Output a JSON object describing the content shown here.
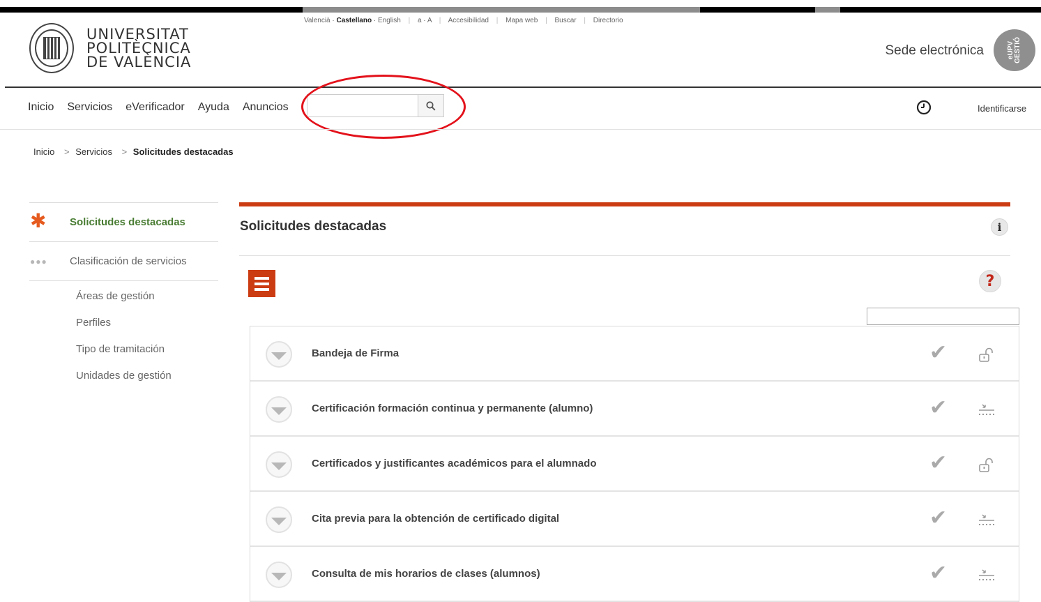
{
  "header": {
    "logo_lines": [
      "UNIVERSITAT",
      "POLITÈCNICA",
      "DE VALÈNCIA"
    ],
    "utility_links": {
      "valencia": "Valencià",
      "castellano": "Castellano",
      "english": "English",
      "text_size": "a · A",
      "accesibilidad": "Accesibilidad",
      "mapa_web": "Mapa web",
      "buscar": "Buscar",
      "directorio": "Directorio"
    },
    "sede": "Sede electrónica",
    "badge": "eUPV\nGESTIÓ"
  },
  "nav": {
    "items": [
      "Inicio",
      "Servicios",
      "eVerificador",
      "Ayuda",
      "Anuncios"
    ],
    "search_placeholder": "",
    "identificarse": "Identificarse"
  },
  "breadcrumb": {
    "items": [
      "Inicio",
      "Servicios"
    ],
    "current": "Solicitudes destacadas"
  },
  "sidebar": {
    "active": "Solicitudes destacadas",
    "section": "Clasificación de servicios",
    "sub_items": [
      "Áreas de gestión",
      "Perfiles",
      "Tipo de tramitación",
      "Unidades de gestión"
    ]
  },
  "main": {
    "title": "Solicitudes destacadas",
    "info": "i",
    "help": "?",
    "rows": [
      {
        "title": "Bandeja de Firma",
        "icon": "unlock-icon"
      },
      {
        "title": "Certificación formación continua y permanente (alumno)",
        "icon": "download-icon"
      },
      {
        "title": "Certificados y justificantes académicos para el alumnado",
        "icon": "unlock-icon"
      },
      {
        "title": "Cita previa para la obtención de certificado digital",
        "icon": "download-icon"
      },
      {
        "title": "Consulta de mis horarios de clases (alumnos)",
        "icon": "download-icon"
      }
    ]
  },
  "colors": {
    "accent": "#cc3c13",
    "active_green": "#4a7d34",
    "annotation_red": "#e3121b"
  }
}
